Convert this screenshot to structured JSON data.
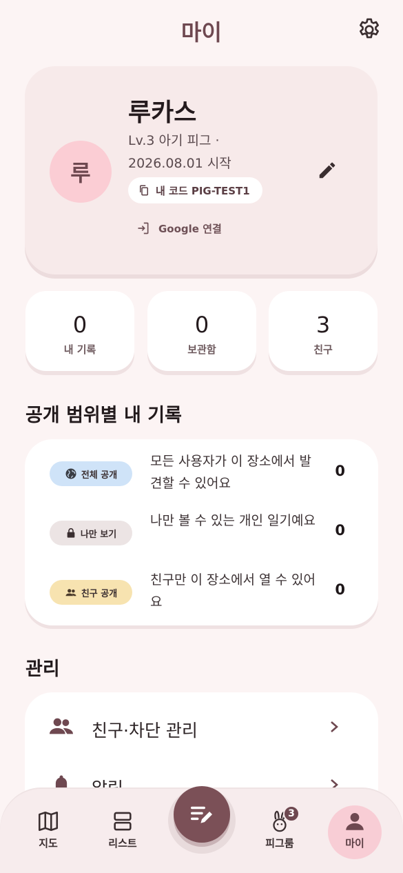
{
  "header": {
    "title": "마이",
    "settings_icon": "gear-icon"
  },
  "profile": {
    "avatar_text": "루",
    "name": "루카스",
    "level_line": "Lv.3 아기 피그 · 2026.08.01 시작",
    "code_label": "내 코드 PIG-TEST1",
    "google_link": "Google 연결"
  },
  "stats": [
    {
      "value": "0",
      "label": "내 기록"
    },
    {
      "value": "0",
      "label": "보관함"
    },
    {
      "value": "3",
      "label": "친구"
    }
  ],
  "visibility_section": {
    "title": "공개 범위별 내 기록",
    "rows": [
      {
        "badge": "전체 공개",
        "badge_color": "#cfe3f8",
        "icon": "globe-icon",
        "description": "모든 사용자가 이 장소에서 발견할 수 있어요",
        "count": "0"
      },
      {
        "badge": "나만 보기",
        "badge_color": "#ece4e4",
        "icon": "lock-icon",
        "description": "나만 볼 수 있는 개인 일기예요",
        "count": "0"
      },
      {
        "badge": "친구 공개",
        "badge_color": "#f7e3b0",
        "icon": "people-icon",
        "description": "친구만 이 장소에서 열 수 있어요",
        "count": "0"
      }
    ]
  },
  "manage_section": {
    "title": "관리",
    "items": [
      {
        "label": "친구·차단 관리",
        "icon": "people-icon"
      },
      {
        "label": "알림",
        "icon": "bell-icon"
      }
    ]
  },
  "bottom_nav": {
    "items": [
      {
        "label": "지도",
        "icon": "map-icon"
      },
      {
        "label": "리스트",
        "icon": "list-icon"
      },
      {
        "label": "피그룸",
        "icon": "rabbit-icon",
        "badge": "3"
      },
      {
        "label": "마이",
        "icon": "person-icon",
        "active": true
      }
    ],
    "fab_icon": "write-icon"
  },
  "colors": {
    "accent": "#6e4850",
    "avatar_bg": "#fbcdd4",
    "background": "#fcf4f4"
  }
}
